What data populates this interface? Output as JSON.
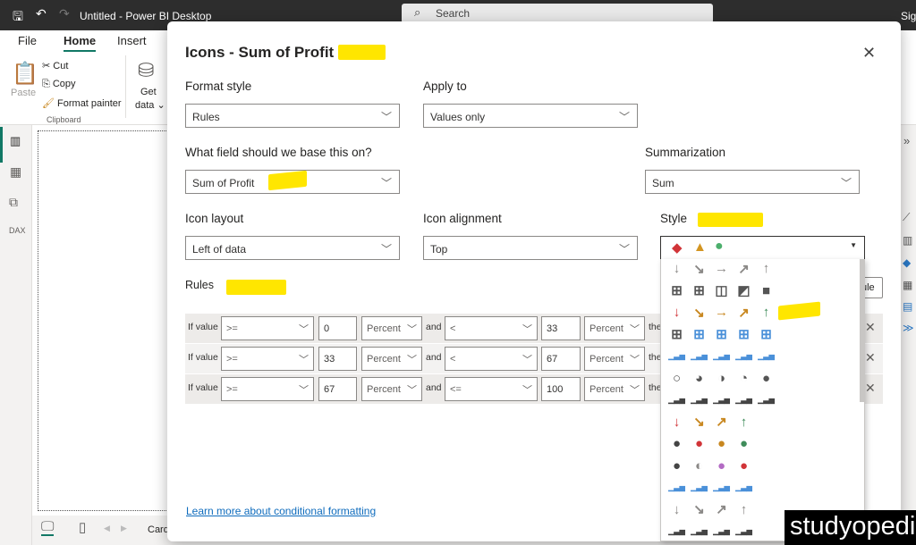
{
  "app": {
    "title": "Untitled - Power BI Desktop",
    "search_placeholder": "Search",
    "sign_in": "Sign"
  },
  "ribbon": {
    "tabs": [
      "File",
      "Home",
      "Insert"
    ],
    "active_tab": "Home",
    "paste": "Paste",
    "cut": "Cut",
    "copy": "Copy",
    "format_painter": "Format painter",
    "clipboard_group": "Clipboard",
    "get_data_1": "Get",
    "get_data_2": "data"
  },
  "bottom": {
    "page_tab": "Card"
  },
  "dialog": {
    "title": "Icons - Sum of Profit",
    "format_style": {
      "label": "Format style",
      "value": "Rules"
    },
    "apply_to": {
      "label": "Apply to",
      "value": "Values only"
    },
    "base_field": {
      "label": "What field should we base this on?",
      "value": "Sum of Profit"
    },
    "summarization": {
      "label": "Summarization",
      "value": "Sum"
    },
    "icon_layout": {
      "label": "Icon layout",
      "value": "Left of data"
    },
    "icon_alignment": {
      "label": "Icon alignment",
      "value": "Top"
    },
    "style": {
      "label": "Style",
      "selected_icons": [
        "red-diamond",
        "yellow-triangle",
        "green-circle"
      ]
    },
    "rules_label": "Rules",
    "new_rule_partial": "ule",
    "rules": [
      {
        "if": "If value",
        "op1": ">=",
        "v1": "0",
        "t1": "Percent",
        "and": "and",
        "op2": "<",
        "v2": "33",
        "t2": "Percent",
        "then": "the"
      },
      {
        "if": "If value",
        "op1": ">=",
        "v1": "33",
        "t1": "Percent",
        "and": "and",
        "op2": "<",
        "v2": "67",
        "t2": "Percent",
        "then": "the"
      },
      {
        "if": "If value",
        "op1": ">=",
        "v1": "67",
        "t1": "Percent",
        "and": "and",
        "op2": "<=",
        "v2": "100",
        "t2": "Percent",
        "then": "the"
      }
    ],
    "learn_more": "Learn more about conditional formatting"
  },
  "style_options": [
    [
      "arrow-down-gray",
      "arrow-downright-gray",
      "arrow-right-gray",
      "arrow-upright-gray",
      "arrow-up-gray"
    ],
    [
      "quarters-0",
      "quarters-1",
      "quarters-2",
      "quarters-3",
      "quarters-4"
    ],
    [
      "arrow-down-red",
      "arrow-downright-orange",
      "arrow-right-orange",
      "arrow-upright-orange",
      "arrow-up-green"
    ],
    [
      "boxes-0",
      "boxes-1",
      "boxes-2",
      "boxes-3",
      "boxes-4"
    ],
    [
      "bars-blue-0",
      "bars-blue-1",
      "bars-blue-2",
      "bars-blue-3",
      "bars-blue-4"
    ],
    [
      "pie-0",
      "pie-3q",
      "pie-half",
      "pie-1q",
      "pie-full"
    ],
    [
      "bars-dark-0",
      "bars-dark-1",
      "bars-dark-2",
      "bars-dark-3",
      "bars-dark-4"
    ],
    [
      "arrow-down-red",
      "arrow-downright-orange",
      "arrow-upright-orange",
      "arrow-up-green"
    ],
    [
      "circle-black",
      "circle-red-down",
      "circle-orange-minus",
      "circle-green-up"
    ],
    [
      "circle-black",
      "circle-gray-half",
      "circle-purple-slash",
      "circle-red-down"
    ],
    [
      "bars-blue-1",
      "bars-blue-2",
      "bars-blue-3",
      "bars-blue-4"
    ],
    [
      "arrow-down-gray",
      "arrow-downright-gray",
      "arrow-upright-gray",
      "arrow-up-gray"
    ],
    [
      "bars-dark-1",
      "bars-dark-2",
      "bars-dark-3",
      "bars-dark-4"
    ]
  ],
  "colors": {
    "accent": "#117865",
    "red": "#d13438",
    "orange": "#c8871f",
    "green": "#3f8c5a",
    "gray": "#8a8886",
    "highlight": "#ffe600"
  },
  "watermark": "studyopedia"
}
